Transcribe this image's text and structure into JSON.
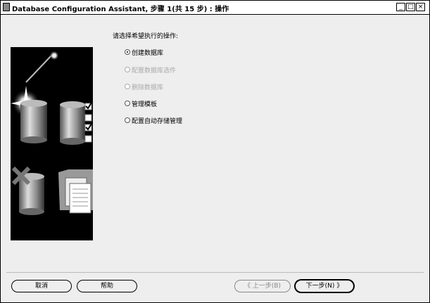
{
  "window": {
    "title": "Database Configuration Assistant, 步骤 1(共 15 步) : 操作",
    "minimize_glyph": "_",
    "maximize_glyph": "□",
    "close_glyph": "×"
  },
  "main": {
    "prompt": "请选择希望执行的操作:",
    "options": [
      {
        "label": "创建数据库",
        "selected": true,
        "enabled": true
      },
      {
        "label": "配置数据库选件",
        "selected": false,
        "enabled": false
      },
      {
        "label": "删除数据库",
        "selected": false,
        "enabled": false
      },
      {
        "label": "管理模板",
        "selected": false,
        "enabled": true
      },
      {
        "label": "配置自动存储管理",
        "selected": false,
        "enabled": true
      }
    ]
  },
  "footer": {
    "cancel_label": "取消",
    "help_label": "帮助",
    "back_label": "上一步(B)",
    "back_arrow": "《",
    "next_label": "下一步(N)",
    "next_arrow": "》"
  }
}
